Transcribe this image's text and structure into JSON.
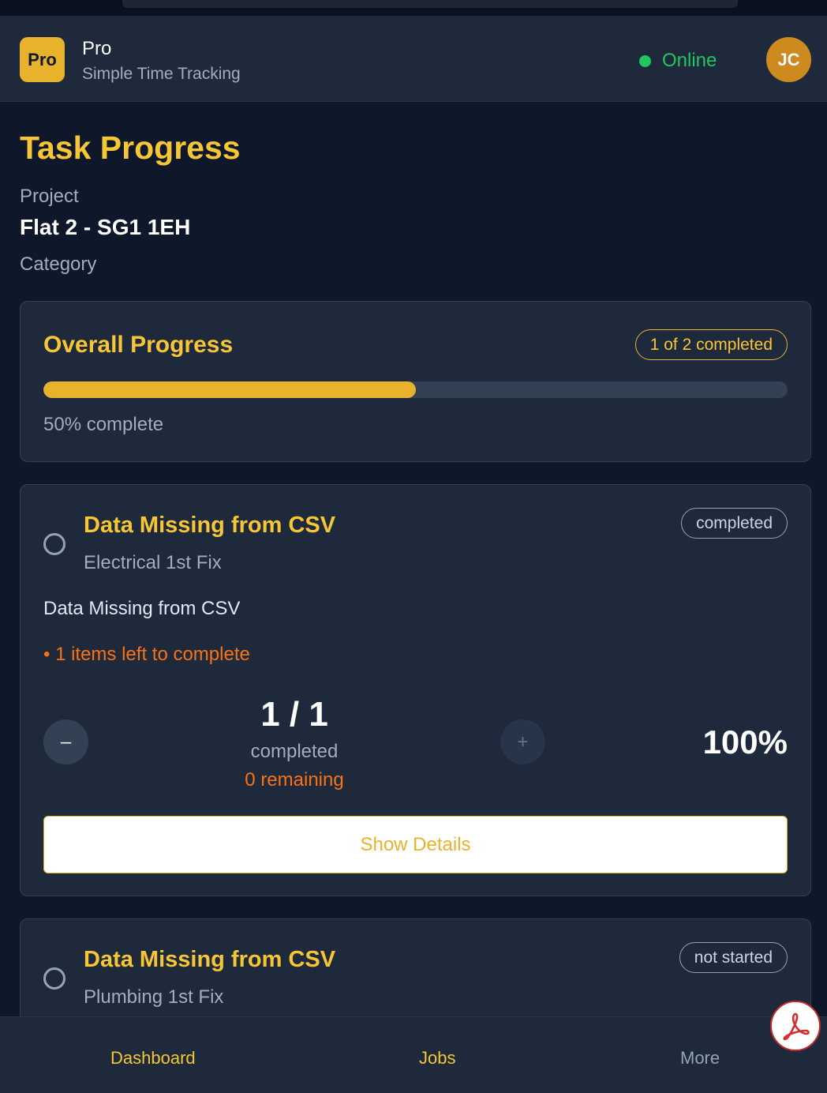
{
  "header": {
    "logo_text": "Pro",
    "app_name": "Pro",
    "app_subtitle": "Simple Time Tracking",
    "status_text": "Online",
    "avatar_initials": "JC"
  },
  "page": {
    "title": "Task Progress",
    "project_label": "Project",
    "project_name": "Flat 2 - SG1 1EH",
    "category_label": "Category"
  },
  "overall": {
    "title": "Overall Progress",
    "badge": "1 of 2 completed",
    "progress_fraction": 0.5,
    "percent_text": "50% complete"
  },
  "tasks": [
    {
      "title": "Data Missing from CSV",
      "category": "Electrical 1st Fix",
      "status": "completed",
      "description": "Data Missing from CSV",
      "items_left": "• 1 items left to complete",
      "minus_label": "–",
      "plus_label": "+",
      "count": "1 / 1",
      "count_label": "completed",
      "remaining": "0 remaining",
      "percent": "100%",
      "details_button": "Show Details"
    },
    {
      "title": "Data Missing from CSV",
      "category": "Plumbing 1st Fix",
      "status": "not started"
    }
  ],
  "nav": {
    "dashboard": "Dashboard",
    "jobs": "Jobs",
    "more": "More"
  },
  "icons": {
    "status_dot": "online-dot-icon",
    "pdf": "pdf-icon",
    "radio": "radio-circle-icon"
  },
  "colors": {
    "accent": "#f6c634",
    "online": "#22c55e",
    "warning": "#f97316",
    "background": "#0f172a",
    "card": "#1e293b"
  }
}
